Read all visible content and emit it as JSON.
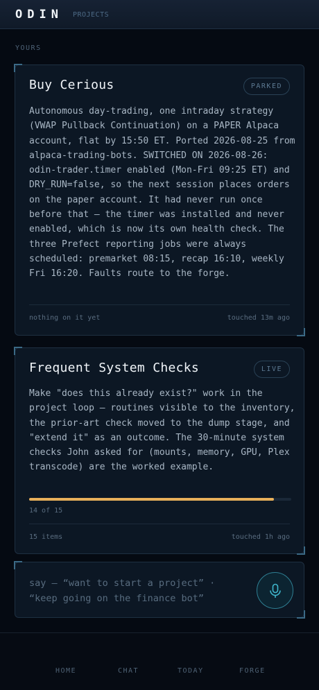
{
  "header": {
    "brand": "ODIN",
    "section": "PROJECTS"
  },
  "list_heading": "YOURS",
  "projects": [
    {
      "title": "Buy Cerious",
      "status": "PARKED",
      "description": "Autonomous day-trading, one intraday strategy (VWAP Pullback Continuation) on a PAPER Alpaca account, flat by 15:50 ET. Ported 2026-08-25 from alpaca-trading-bots. SWITCHED ON 2026-08-26: odin-trader.timer enabled (Mon-Fri 09:25 ET) and DRY_RUN=false, so the next session places orders on the paper account. It had never run once before that — the timer was installed and never enabled, which is now its own health check. The three Prefect reporting jobs were always scheduled: premarket 08:15, recap 16:10, weekly Fri 16:20. Faults route to the forge.",
      "items_text": "nothing on it yet",
      "touched": "touched 13m ago"
    },
    {
      "title": "Frequent System Checks",
      "status": "LIVE",
      "description": "Make \"does this already exist?\" work in the project loop — routines visible to the inventory, the prior-art check moved to the dump stage, and \"extend it\" as an outcome. The 30-minute system checks John asked for (mounts, memory, GPU, Plex transcode) are the worked example.",
      "progress_done": 14,
      "progress_total": 15,
      "progress_text": "14 of 15",
      "items_text": "15 items",
      "touched": "touched 1h ago"
    }
  ],
  "composer": {
    "prompt_line1": "say — “want to start a project” ·",
    "prompt_line2": "“keep going on the finance bot”",
    "mic_icon": "microphone-icon"
  },
  "nav": {
    "home": "HOME",
    "chat": "CHAT",
    "today": "TODAY",
    "forge": "FORGE"
  },
  "colors": {
    "accent": "#e8b05a",
    "mic": "#3fb6cc",
    "background": "#050a12"
  }
}
